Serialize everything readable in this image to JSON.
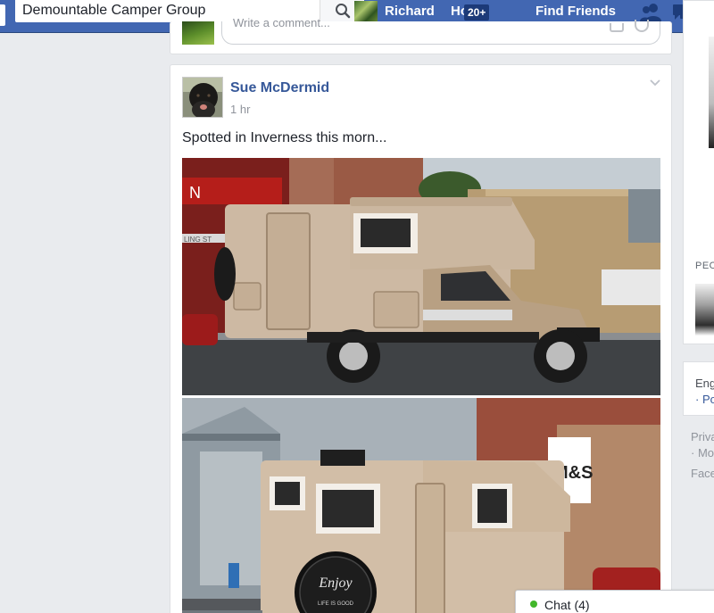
{
  "header": {
    "search_value": "Demountable Camper Group",
    "profile_name": "Richard",
    "home_label": "Home",
    "home_badge": "20+",
    "find_friends_label": "Find Friends"
  },
  "previous_post": {
    "comment_placeholder": "Write a comment..."
  },
  "post": {
    "author": "Sue McDermid",
    "time": "1 hr",
    "text": "Spotted in Inverness this morn...",
    "photo1_sign": "N",
    "photo1_bottom_sign": "LING ST",
    "photo2_store_sign": "M&S",
    "tire_cover_text": "Enjoy",
    "tire_cover_subtext": "LIFE IS GOOD"
  },
  "right_column": {
    "people_label": "PEO",
    "lang_line1": "Eng",
    "lang_line2": "· Po",
    "footer_privacy": "Priva",
    "footer_more": "· Mo",
    "footer_facebook": "Face"
  },
  "chat": {
    "label": "Chat (4)"
  },
  "colors": {
    "brand_blue": "#4267b2",
    "link_blue": "#365899",
    "online_green": "#42b72a"
  }
}
